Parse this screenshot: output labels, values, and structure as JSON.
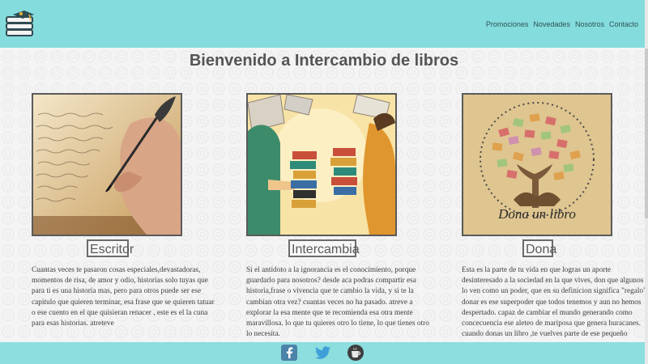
{
  "nav": {
    "items": [
      "Promociones",
      "Novedades",
      "Nosotros",
      "Contacto"
    ]
  },
  "main": {
    "title": "Bienvenido a Intercambio de libros"
  },
  "cards": [
    {
      "title": "Escritor",
      "image": "quill-writing-image",
      "text": "Cuantas veces te pasaron cosas especiales,devastadoras, momentos de risa, de amor y odio, historias solo tuyas que para ti es una historia mas, pero para otros puede ser ese capitulo que quieren terminar, esa frase que se quieren tatuar o ese cuento en el que quisieran renacer , este es el la cuna para esas historias. atreteve"
    },
    {
      "title": "Intercambia",
      "image": "book-exchange-image",
      "text": "Si el antidoto a la ignorancia es el conocimiento, porque guardarlo para nosotros? desde aca podras compartir esa historia,frase o vivencia que te cambio la vida, y si te la cambian otra vez? cuantas veces no ha pasado. atreve a explorar la esa mente que te recomienda esa otra mente maravillosa. lo que tu quieres otro lo tiene, lo que tienes otro lo necesita."
    },
    {
      "title": "Dona",
      "image": "book-tree-image",
      "image_caption": "Dona un libro",
      "text": "Esta es la parte de tu vida en que logras un aporte desinteresado a la sociedad en la que vives, don que algunos lo ven como un poder, que en su definicion significa \"regalo\" donar es ese superpoder que todos tenemos y aun no hemos despertado. capaz de cambiar el mundo generando como concecuencia ese aleteo de mariposa que genera huracanes. cuando donas un libro ,te vuelves parte de ese pequeño"
    }
  ],
  "footer": {
    "icons": [
      "facebook-icon",
      "twitter-icon",
      "coffee-icon"
    ]
  },
  "colors": {
    "brand": "#84dcdc",
    "title_text": "#555555"
  }
}
